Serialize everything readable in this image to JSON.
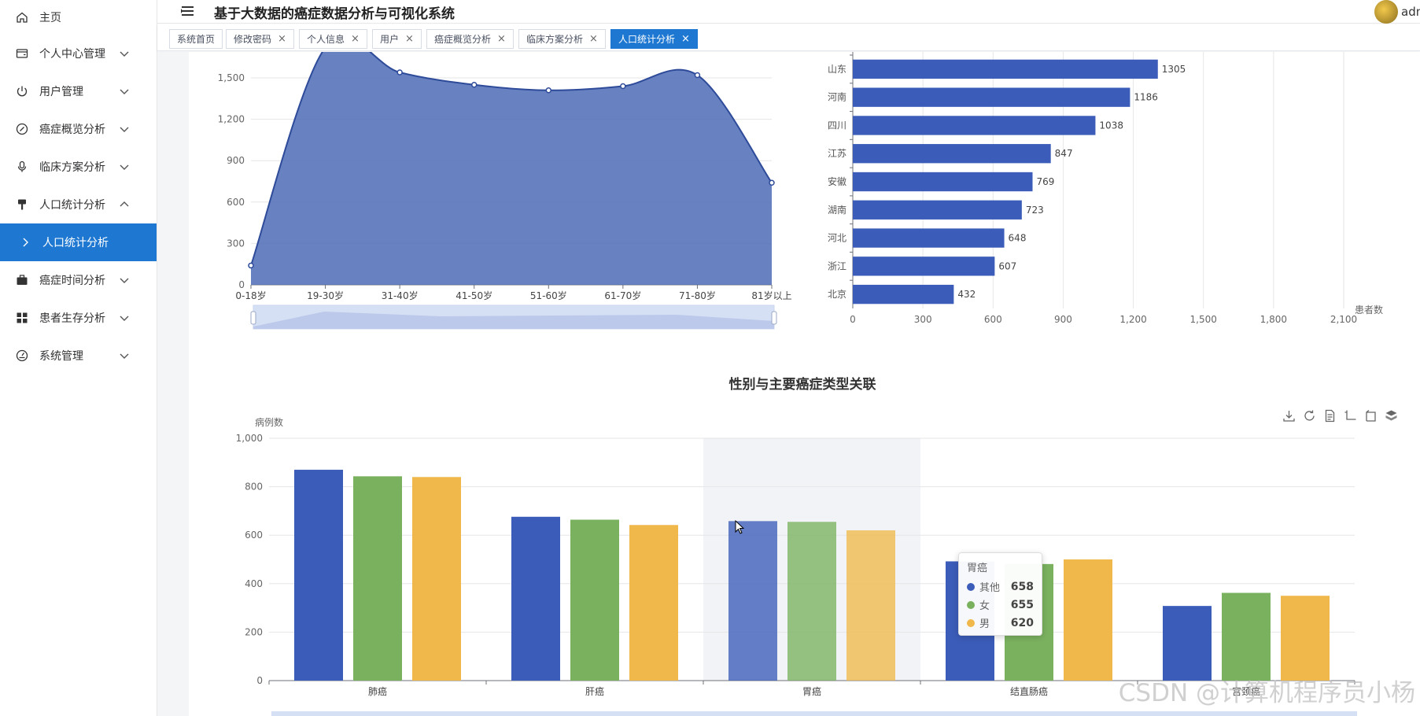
{
  "header": {
    "title": "基于大数据的癌症数据分析与可视化系统",
    "user": "admin"
  },
  "sidebar": {
    "items": [
      {
        "label": "主页",
        "icon": "home-icon",
        "arrow": ""
      },
      {
        "label": "个人中心管理",
        "icon": "wallet-icon",
        "arrow": "down"
      },
      {
        "label": "用户管理",
        "icon": "power-icon",
        "arrow": "down"
      },
      {
        "label": "癌症概览分析",
        "icon": "compass-icon",
        "arrow": "down"
      },
      {
        "label": "临床方案分析",
        "icon": "microphone-icon",
        "arrow": "down"
      },
      {
        "label": "人口统计分析",
        "icon": "brush-icon",
        "arrow": "up"
      },
      {
        "label": "人口统计分析",
        "icon": "chevron-right-icon",
        "arrow": "",
        "active": true
      },
      {
        "label": "癌症时间分析",
        "icon": "briefcase-icon",
        "arrow": "down"
      },
      {
        "label": "患者生存分析",
        "icon": "grid-icon",
        "arrow": "down"
      },
      {
        "label": "系统管理",
        "icon": "gauge-icon",
        "arrow": "down"
      }
    ]
  },
  "tabs": [
    {
      "label": "系统首页",
      "closable": false
    },
    {
      "label": "修改密码",
      "closable": true
    },
    {
      "label": "个人信息",
      "closable": true
    },
    {
      "label": "用户",
      "closable": true
    },
    {
      "label": "癌症概览分析",
      "closable": true
    },
    {
      "label": "临床方案分析",
      "closable": true
    },
    {
      "label": "人口统计分析",
      "closable": true,
      "active": true
    }
  ],
  "tab_close_glyph": "×",
  "colors": {
    "accent": "#1e78d2",
    "blue": "#3b5cb8",
    "green": "#7ab15f",
    "yellow": "#f0b84a"
  },
  "chart_data": [
    {
      "type": "area",
      "categories": [
        "0-18岁",
        "19-30岁",
        "31-40岁",
        "41-50岁",
        "51-60岁",
        "61-70岁",
        "71-80岁",
        "81岁以上"
      ],
      "values": [
        140,
        1720,
        1540,
        1450,
        1410,
        1440,
        1520,
        740
      ],
      "yticks": [
        0,
        300,
        600,
        900,
        1200,
        1500
      ],
      "ylim": [
        0,
        1500
      ],
      "grid": true,
      "datazoom": true
    },
    {
      "type": "bar",
      "orientation": "horizontal",
      "categories": [
        "山东",
        "河南",
        "四川",
        "江苏",
        "安徽",
        "湖南",
        "河北",
        "浙江",
        "北京"
      ],
      "values": [
        1305,
        1186,
        1038,
        847,
        769,
        723,
        648,
        607,
        432
      ],
      "xlabel": "患者数",
      "xticks": [
        0,
        300,
        600,
        900,
        1200,
        1500,
        1800,
        2100
      ],
      "xlim": [
        0,
        2100
      ],
      "grid": true
    },
    {
      "type": "bar",
      "title": "性别与主要癌症类型关联",
      "ylabel": "病例数",
      "categories": [
        "肺癌",
        "肝癌",
        "胃癌",
        "结直肠癌",
        "宫颈癌"
      ],
      "series": [
        {
          "name": "其他",
          "values": [
            870,
            676,
            658,
            492,
            308
          ],
          "color": "#3b5cb8"
        },
        {
          "name": "女",
          "values": [
            843,
            664,
            655,
            481,
            362
          ],
          "color": "#7ab15f"
        },
        {
          "name": "男",
          "values": [
            840,
            642,
            620,
            500,
            350
          ],
          "color": "#f0b84a"
        }
      ],
      "yticks": [
        0,
        200,
        400,
        600,
        800,
        1000
      ],
      "ylim": [
        0,
        1000
      ],
      "grid": true,
      "highlighted_category": "胃癌",
      "tooltip": {
        "title": "胃癌",
        "rows": [
          {
            "name": "其他",
            "value": "658"
          },
          {
            "name": "女",
            "value": "655"
          },
          {
            "name": "男",
            "value": "620"
          }
        ]
      }
    }
  ],
  "watermark": "CSDN @计算机程序员小杨"
}
